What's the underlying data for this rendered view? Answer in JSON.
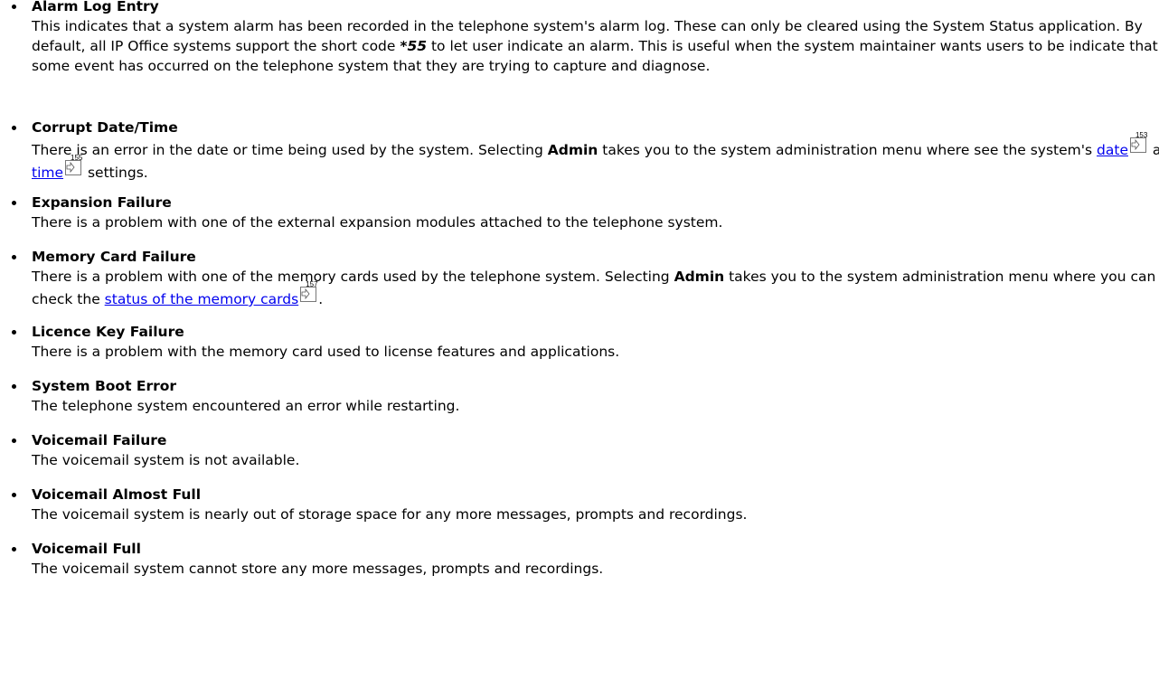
{
  "items": [
    {
      "title": "Alarm Log Entry",
      "desc_before": "This indicates that a system alarm has been recorded in the telephone system's alarm log. These can only be cleared using the System Status application. By default, all IP Office systems support the short code ",
      "short_code": "*55",
      "desc_after": " to let user indicate an alarm. This is useful when the system maintainer wants users to be indicate that some event has occurred on the telephone system that they are trying to capture and diagnose."
    },
    {
      "title": "Corrupt Date/Time",
      "desc_1": "There is an error in the date or time being used by the system. Selecting ",
      "bold_1": "Admin",
      "desc_2": " takes you to the system administration menu where see the system's ",
      "link_1": "date",
      "page_1": "153",
      "desc_3": " and ",
      "link_2": "time",
      "page_2": "155",
      "desc_4": " settings."
    },
    {
      "title": "Expansion Failure",
      "desc": "There is a problem with one of the external expansion modules attached to the telephone system."
    },
    {
      "title": "Memory Card Failure",
      "desc_1": "There is a problem with one of the memory cards used by the telephone system. Selecting ",
      "bold_1": "Admin",
      "desc_2": " takes you to the system administration menu where you can check the ",
      "link_1": "status of the memory cards",
      "page_1": "157",
      "desc_3": "."
    },
    {
      "title": "Licence Key Failure",
      "desc": "There is a problem with the memory card used to license features and applications."
    },
    {
      "title": "System Boot Error",
      "desc": "The telephone system encountered an error while restarting."
    },
    {
      "title": "Voicemail Failure",
      "desc": "The voicemail system is not available."
    },
    {
      "title": "Voicemail Almost Full",
      "desc": "The voicemail system is nearly out of storage space for any more messages, prompts and recordings."
    },
    {
      "title": "Voicemail Full",
      "desc": "The voicemail system cannot store any more messages, prompts and recordings."
    }
  ]
}
